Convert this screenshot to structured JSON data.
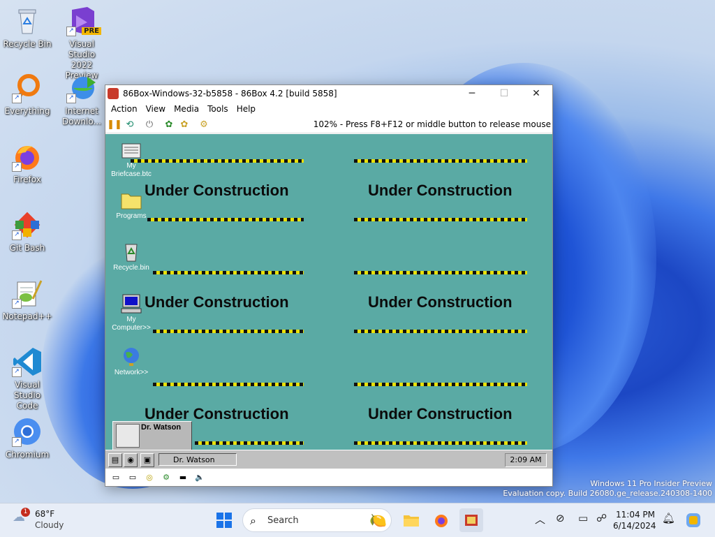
{
  "desktop": {
    "icons": [
      {
        "label": "Recycle Bin",
        "icon": "recycle-bin-icon"
      },
      {
        "label": "Visual Studio 2022 Preview",
        "icon": "visual-studio-preview-icon",
        "badge": "PRE"
      },
      {
        "label": "Everything",
        "icon": "everything-search-icon"
      },
      {
        "label": "Internet Downlo...",
        "icon": "internet-download-manager-icon"
      },
      {
        "label": "Firefox",
        "icon": "firefox-icon"
      },
      {
        "label": "Git Bash",
        "icon": "git-bash-icon"
      },
      {
        "label": "Notepad++",
        "icon": "notepad-plus-plus-icon"
      },
      {
        "label": "Visual Studio Code",
        "icon": "vscode-icon"
      },
      {
        "label": "Chromium",
        "icon": "chromium-icon"
      }
    ],
    "watermark": {
      "line1": "Windows 11 Pro Insider Preview",
      "line2": "Evaluation copy. Build 26080.ge_release.240308-1400"
    }
  },
  "window": {
    "title": "86Box-Windows-32-b5858 - 86Box 4.2 [build 5858]",
    "menu": [
      "Action",
      "View",
      "Media",
      "Tools",
      "Help"
    ],
    "toolbar_status": "102% - Press F8+F12 or middle button to release mouse",
    "controls": {
      "minimize": "─",
      "maximize": "☐",
      "close": "✕"
    }
  },
  "vm_screen": {
    "background": "#5aaaa4",
    "banner_text": "Under Construction",
    "icons": [
      {
        "label": "My Briefcase.btc",
        "icon": "briefcase-icon"
      },
      {
        "label": "Programs",
        "icon": "folder-icon"
      },
      {
        "label": "Recycle.bin",
        "icon": "recycle-bin-icon"
      },
      {
        "label": "My Computer>>",
        "icon": "computer-icon"
      },
      {
        "label": "Network>>",
        "icon": "network-globe-icon"
      }
    ],
    "popup_title": "Dr. Watson",
    "taskbar": {
      "task_label": "Dr. Watson",
      "clock": "2:09 AM"
    }
  },
  "taskbar": {
    "weather": {
      "temp": "68°F",
      "condition": "Cloudy",
      "badge": "1"
    },
    "search_placeholder": "Search",
    "clock": {
      "time": "11:04 PM",
      "date": "6/14/2024"
    }
  }
}
